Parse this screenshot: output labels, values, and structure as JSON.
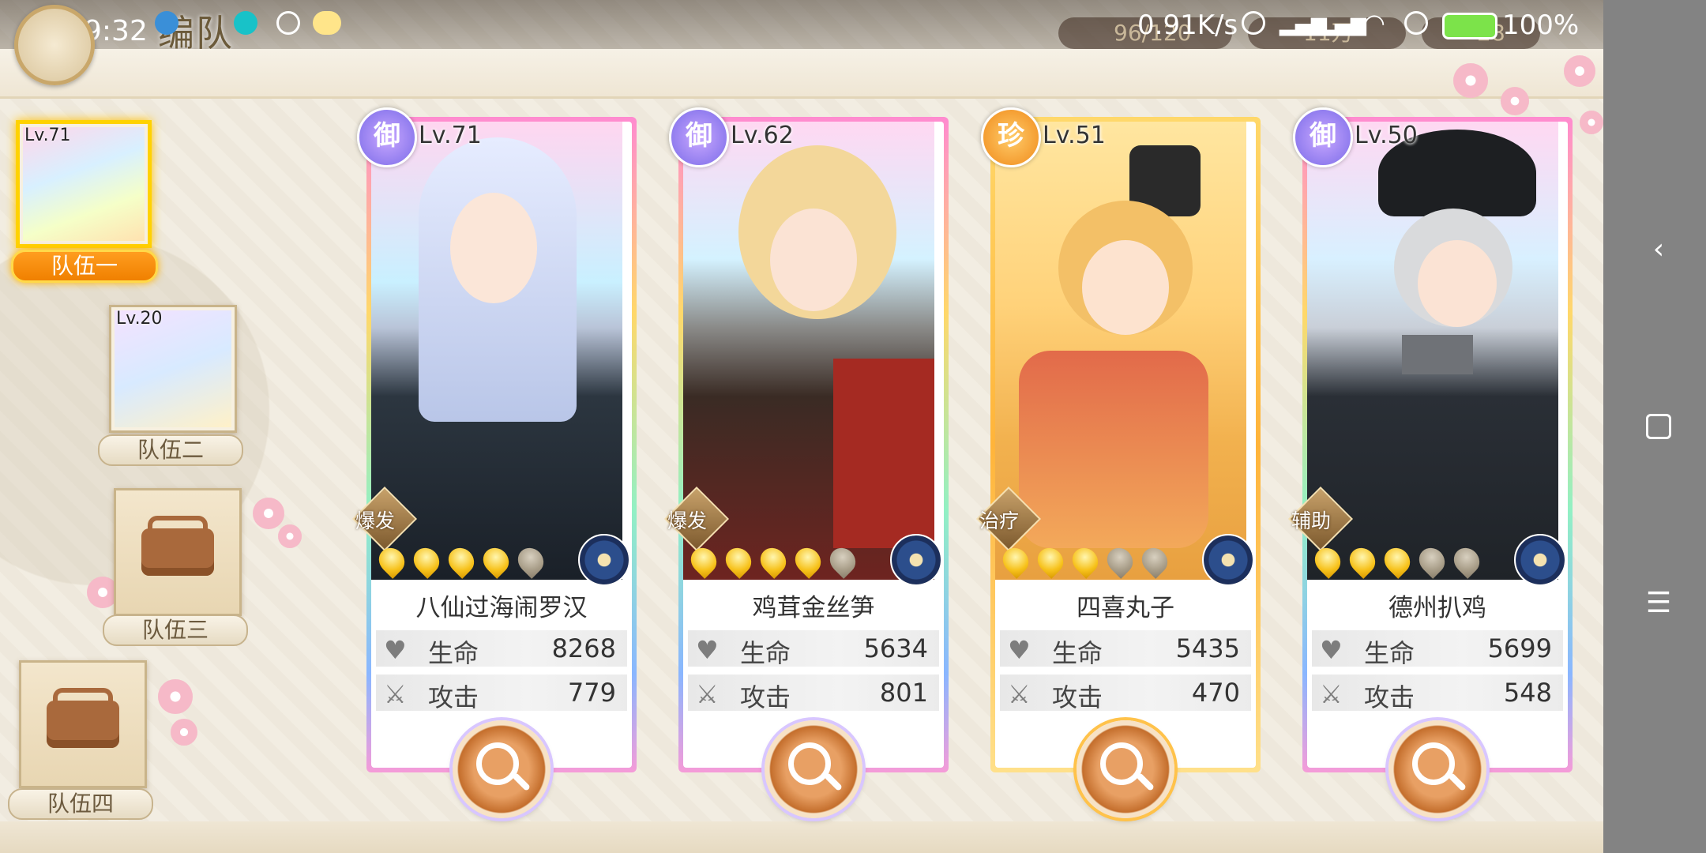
{
  "status_bar": {
    "time": "晚上9:32",
    "title": "编队",
    "network_speed": "0.91K/s",
    "battery": "100%",
    "resource_1": "96/120",
    "resource_2": "11万",
    "resource_3": "28"
  },
  "teams": [
    {
      "label": "队伍一",
      "level": "Lv.71",
      "active": true
    },
    {
      "label": "队伍二",
      "level": "Lv.20",
      "active": false
    },
    {
      "label": "队伍三",
      "level": "",
      "active": false
    },
    {
      "label": "队伍四",
      "level": "",
      "active": false
    }
  ],
  "cards": [
    {
      "rarity": "御",
      "level": "Lv.71",
      "role": "爆发",
      "name": "八仙过海闹罗汉",
      "stars": 4,
      "hp_label": "生命",
      "hp": "8268",
      "atk_label": "攻击",
      "atk": "779"
    },
    {
      "rarity": "御",
      "level": "Lv.62",
      "role": "爆发",
      "name": "鸡茸金丝笋",
      "stars": 4,
      "hp_label": "生命",
      "hp": "5634",
      "atk_label": "攻击",
      "atk": "801"
    },
    {
      "rarity": "珍",
      "level": "Lv.51",
      "role": "治疗",
      "name": "四喜丸子",
      "stars": 3,
      "hp_label": "生命",
      "hp": "5435",
      "atk_label": "攻击",
      "atk": "470"
    },
    {
      "rarity": "御",
      "level": "Lv.50",
      "role": "辅助",
      "name": "德州扒鸡",
      "stars": 3,
      "hp_label": "生命",
      "hp": "5699",
      "atk_label": "攻击",
      "atk": "548"
    }
  ],
  "icons": {
    "hp": "heart-icon",
    "atk": "sword-icon",
    "detail": "magnifier-icon",
    "nav": [
      "back-icon",
      "home-icon",
      "menu-icon"
    ]
  },
  "colors": {
    "active_team": "#ff9d1f",
    "active_border": "#ffd200",
    "nav_bar": "#838383"
  }
}
